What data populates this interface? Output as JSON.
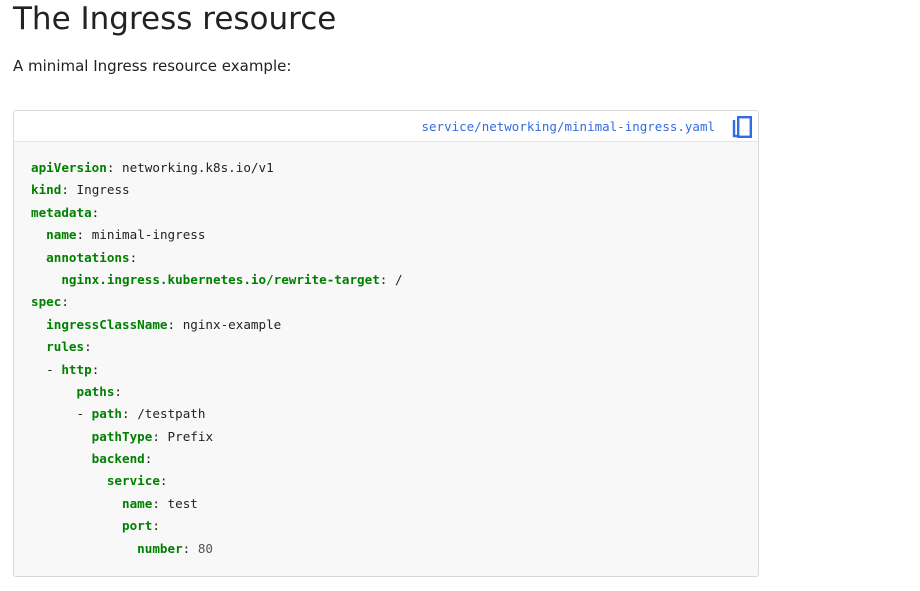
{
  "page": {
    "title": "The Ingress resource",
    "intro": "A minimal Ingress resource example:"
  },
  "code_block": {
    "file_path": "service/networking/minimal-ingress.yaml",
    "copy_icon": "copy-icon",
    "lines": [
      {
        "indent": "",
        "dash": "",
        "key": "apiVersion",
        "value": "networking.k8s.io/v1"
      },
      {
        "indent": "",
        "dash": "",
        "key": "kind",
        "value": "Ingress"
      },
      {
        "indent": "",
        "dash": "",
        "key": "metadata",
        "value": ""
      },
      {
        "indent": "  ",
        "dash": "",
        "key": "name",
        "value": "minimal-ingress"
      },
      {
        "indent": "  ",
        "dash": "",
        "key": "annotations",
        "value": ""
      },
      {
        "indent": "    ",
        "dash": "",
        "key": "nginx.ingress.kubernetes.io/rewrite-target",
        "value": "/"
      },
      {
        "indent": "",
        "dash": "",
        "key": "spec",
        "value": ""
      },
      {
        "indent": "  ",
        "dash": "",
        "key": "ingressClassName",
        "value": "nginx-example"
      },
      {
        "indent": "  ",
        "dash": "",
        "key": "rules",
        "value": ""
      },
      {
        "indent": "  ",
        "dash": "- ",
        "key": "http",
        "value": ""
      },
      {
        "indent": "      ",
        "dash": "",
        "key": "paths",
        "value": ""
      },
      {
        "indent": "      ",
        "dash": "- ",
        "key": "path",
        "value": "/testpath"
      },
      {
        "indent": "        ",
        "dash": "",
        "key": "pathType",
        "value": "Prefix"
      },
      {
        "indent": "        ",
        "dash": "",
        "key": "backend",
        "value": ""
      },
      {
        "indent": "          ",
        "dash": "",
        "key": "service",
        "value": ""
      },
      {
        "indent": "            ",
        "dash": "",
        "key": "name",
        "value": "test"
      },
      {
        "indent": "            ",
        "dash": "",
        "key": "port",
        "value": ""
      },
      {
        "indent": "              ",
        "dash": "",
        "key": "number",
        "value": "80",
        "numeric": true
      }
    ]
  },
  "colors": {
    "key": "#008000",
    "link": "#326ce5",
    "code_bg": "#f8f8f8"
  }
}
